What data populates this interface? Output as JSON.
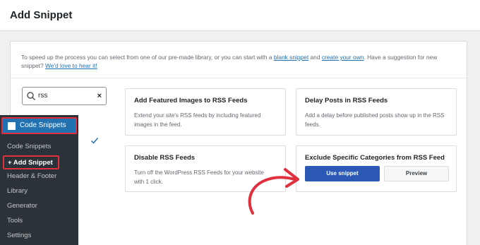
{
  "header": {
    "title": "Add Snippet"
  },
  "intro": {
    "text_before": "To speed up the process you can select from one of our pre-made library, or you can start with a ",
    "link_blank": "blank snippet",
    "text_and": " and ",
    "link_create": "create your own",
    "text_after": ". Have a suggestion for new snippet? ",
    "link_suggest": "We'd love to hear it!"
  },
  "search": {
    "value": "rss",
    "clear_label": "×"
  },
  "cards": [
    {
      "title": "Add Featured Images to RSS Feeds",
      "desc": "Extend your site's RSS feeds by including featured images in the feed."
    },
    {
      "title": "Delay Posts in RSS Feeds",
      "desc": "Add a delay before published posts show up in the RSS feeds."
    },
    {
      "title": "Disable RSS Feeds",
      "desc": "Turn off the WordPress RSS Feeds for your website with 1 click."
    },
    {
      "title": "Exclude Specific Categories from RSS Feed",
      "use_label": "Use snippet",
      "preview_label": "Preview"
    }
  ],
  "admin_menu": {
    "head": "Code Snippets",
    "items": [
      "Code Snippets",
      "+ Add Snippet",
      "Header & Footer",
      "Library",
      "Generator",
      "Tools",
      "Settings"
    ]
  },
  "colors": {
    "primary": "#2b59b5",
    "highlight": "#e0303e",
    "admin_bg": "#2c3338",
    "menu_active": "#2271b1"
  }
}
